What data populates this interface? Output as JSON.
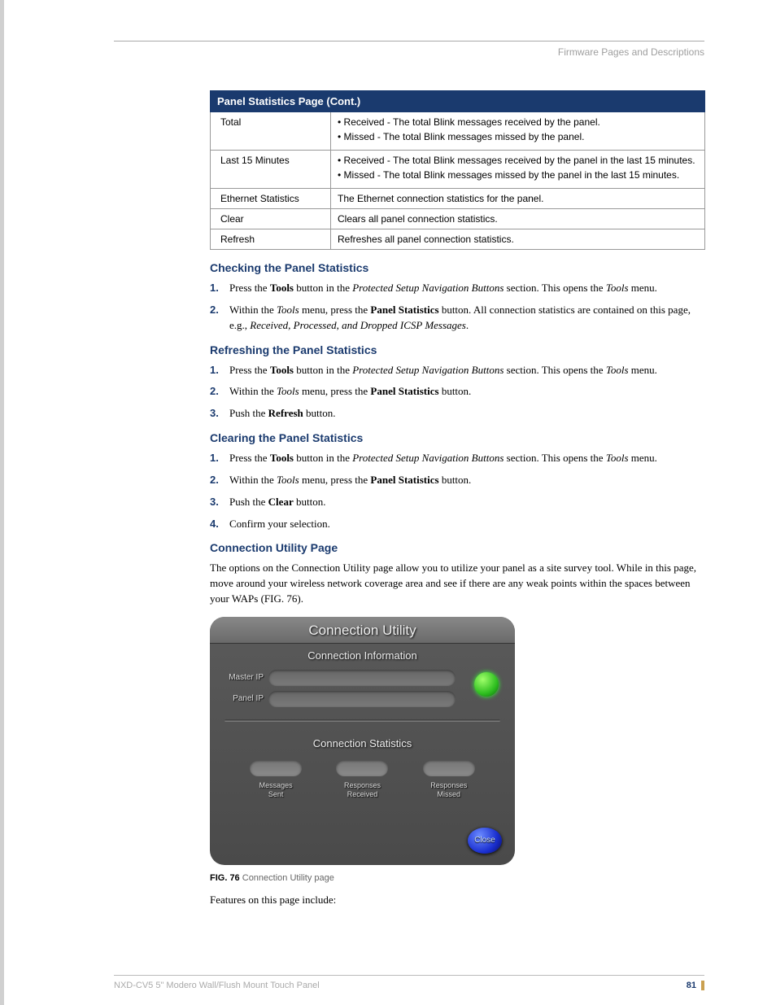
{
  "header": {
    "section_title": "Firmware Pages and Descriptions"
  },
  "table": {
    "title": "Panel Statistics Page (Cont.)",
    "rows": [
      {
        "label": "Total",
        "lines": [
          "•  Received - The total Blink messages received by the panel.",
          "•  Missed - The total Blink messages missed by the panel."
        ]
      },
      {
        "label": "Last 15 Minutes",
        "lines": [
          "•  Received - The total Blink messages received by the panel in the last 15 minutes.",
          "•  Missed - The total Blink messages missed by the panel in the last 15 minutes."
        ]
      },
      {
        "label": "Ethernet Statistics",
        "lines": [
          "The Ethernet connection statistics for the panel."
        ]
      },
      {
        "label": "Clear",
        "lines": [
          "Clears all panel connection statistics."
        ]
      },
      {
        "label": "Refresh",
        "lines": [
          "Refreshes all panel connection statistics."
        ]
      }
    ]
  },
  "sections": {
    "checking": {
      "heading": "Checking the Panel Statistics",
      "items": [
        {
          "num": "1.",
          "pre": "Press the ",
          "b1": "Tools",
          "mid1": " button in the ",
          "i1": "Protected Setup Navigation Buttons",
          "mid2": " section. This opens the ",
          "i2": "Tools",
          "post": " menu."
        },
        {
          "num": "2.",
          "pre": "Within the ",
          "i1": "Tools",
          "mid1": " menu, press the ",
          "b1": "Panel Statistics",
          "mid2": " button. All connection statistics are contained on this page, e.g., ",
          "i2": "Received, Processed, and Dropped ICSP Messages",
          "post": "."
        }
      ]
    },
    "refreshing": {
      "heading": "Refreshing the Panel Statistics",
      "items": [
        {
          "num": "1.",
          "pre": "Press the ",
          "b1": "Tools",
          "mid1": " button in the ",
          "i1": "Protected Setup Navigation Buttons",
          "mid2": " section. This opens the ",
          "i2": "Tools",
          "post": " menu."
        },
        {
          "num": "2.",
          "pre": "Within the ",
          "i1": "Tools",
          "mid1": " menu, press the ",
          "b1": "Panel Statistics",
          "post": " button."
        },
        {
          "num": "3.",
          "pre": "Push the ",
          "b1": "Refresh",
          "post": " button."
        }
      ]
    },
    "clearing": {
      "heading": "Clearing the Panel Statistics",
      "items": [
        {
          "num": "1.",
          "pre": "Press the ",
          "b1": "Tools",
          "mid1": " button in the ",
          "i1": "Protected Setup Navigation Buttons",
          "mid2": " section. This opens the ",
          "i2": "Tools",
          "post": " menu."
        },
        {
          "num": "2.",
          "pre": "Within the ",
          "i1": "Tools",
          "mid1": " menu, press the ",
          "b1": "Panel Statistics",
          "post": " button."
        },
        {
          "num": "3.",
          "pre": "Push the ",
          "b1": "Clear",
          "post": " button."
        },
        {
          "num": "4.",
          "pre": "Confirm your selection."
        }
      ]
    },
    "connection": {
      "heading": "Connection Utility Page",
      "para": "The options on the Connection Utility page allow you to utilize your panel as a site survey tool. While in this page, move around your wireless network coverage area and see if there are any weak points within the spaces between your WAPs (FIG. 76)."
    }
  },
  "figure": {
    "panel_title": "Connection Utility",
    "info_title": "Connection Information",
    "master_ip": "Master IP",
    "panel_ip": "Panel IP",
    "stats_title": "Connection Statistics",
    "stat1_a": "Messages",
    "stat1_b": "Sent",
    "stat2_a": "Responses",
    "stat2_b": "Received",
    "stat3_a": "Responses",
    "stat3_b": "Missed",
    "close": "Close",
    "caption_label": "FIG. 76",
    "caption_text": "  Connection Utility page"
  },
  "after_figure": "Features on this page include:",
  "footer": {
    "doc_title": "NXD-CV5 5\" Modero Wall/Flush Mount Touch Panel",
    "page_number": "81"
  }
}
